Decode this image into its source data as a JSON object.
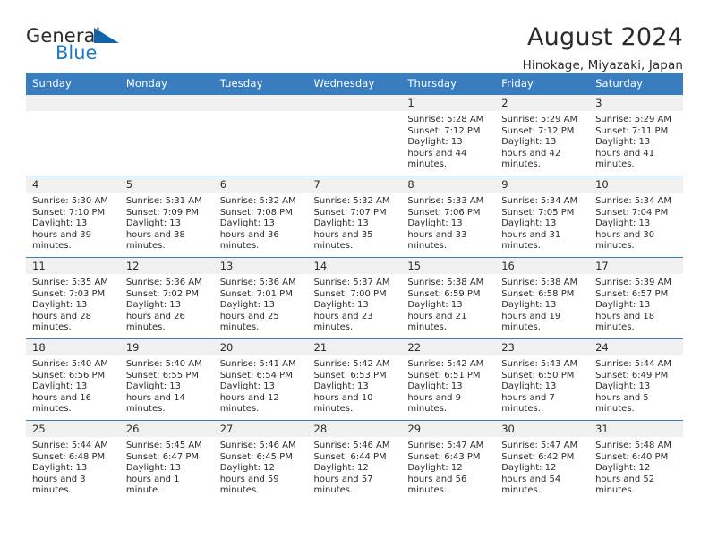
{
  "brand": {
    "name_part1": "General",
    "name_part2": "Blue",
    "flag_icon": "triangle-flag-icon"
  },
  "header": {
    "title": "August 2024",
    "subtitle": "Hinokage, Miyazaki, Japan"
  },
  "colors": {
    "header_blue": "#3a7dbf",
    "brand_blue": "#1f7ac4",
    "flag_blue": "#1164a8",
    "daynum_bg": "#f0f0f0",
    "text": "#2b2b2b"
  },
  "weekdays": [
    "Sunday",
    "Monday",
    "Tuesday",
    "Wednesday",
    "Thursday",
    "Friday",
    "Saturday"
  ],
  "labels": {
    "sunrise_prefix": "Sunrise:",
    "sunset_prefix": "Sunset:",
    "daylight_prefix": "Daylight:"
  },
  "weeks": [
    [
      {
        "day": "",
        "empty": true
      },
      {
        "day": "",
        "empty": true
      },
      {
        "day": "",
        "empty": true
      },
      {
        "day": "",
        "empty": true
      },
      {
        "day": "1",
        "sunrise": "Sunrise: 5:28 AM",
        "sunset": "Sunset: 7:12 PM",
        "daylight": "Daylight: 13 hours and 44 minutes."
      },
      {
        "day": "2",
        "sunrise": "Sunrise: 5:29 AM",
        "sunset": "Sunset: 7:12 PM",
        "daylight": "Daylight: 13 hours and 42 minutes."
      },
      {
        "day": "3",
        "sunrise": "Sunrise: 5:29 AM",
        "sunset": "Sunset: 7:11 PM",
        "daylight": "Daylight: 13 hours and 41 minutes."
      }
    ],
    [
      {
        "day": "4",
        "sunrise": "Sunrise: 5:30 AM",
        "sunset": "Sunset: 7:10 PM",
        "daylight": "Daylight: 13 hours and 39 minutes."
      },
      {
        "day": "5",
        "sunrise": "Sunrise: 5:31 AM",
        "sunset": "Sunset: 7:09 PM",
        "daylight": "Daylight: 13 hours and 38 minutes."
      },
      {
        "day": "6",
        "sunrise": "Sunrise: 5:32 AM",
        "sunset": "Sunset: 7:08 PM",
        "daylight": "Daylight: 13 hours and 36 minutes."
      },
      {
        "day": "7",
        "sunrise": "Sunrise: 5:32 AM",
        "sunset": "Sunset: 7:07 PM",
        "daylight": "Daylight: 13 hours and 35 minutes."
      },
      {
        "day": "8",
        "sunrise": "Sunrise: 5:33 AM",
        "sunset": "Sunset: 7:06 PM",
        "daylight": "Daylight: 13 hours and 33 minutes."
      },
      {
        "day": "9",
        "sunrise": "Sunrise: 5:34 AM",
        "sunset": "Sunset: 7:05 PM",
        "daylight": "Daylight: 13 hours and 31 minutes."
      },
      {
        "day": "10",
        "sunrise": "Sunrise: 5:34 AM",
        "sunset": "Sunset: 7:04 PM",
        "daylight": "Daylight: 13 hours and 30 minutes."
      }
    ],
    [
      {
        "day": "11",
        "sunrise": "Sunrise: 5:35 AM",
        "sunset": "Sunset: 7:03 PM",
        "daylight": "Daylight: 13 hours and 28 minutes."
      },
      {
        "day": "12",
        "sunrise": "Sunrise: 5:36 AM",
        "sunset": "Sunset: 7:02 PM",
        "daylight": "Daylight: 13 hours and 26 minutes."
      },
      {
        "day": "13",
        "sunrise": "Sunrise: 5:36 AM",
        "sunset": "Sunset: 7:01 PM",
        "daylight": "Daylight: 13 hours and 25 minutes."
      },
      {
        "day": "14",
        "sunrise": "Sunrise: 5:37 AM",
        "sunset": "Sunset: 7:00 PM",
        "daylight": "Daylight: 13 hours and 23 minutes."
      },
      {
        "day": "15",
        "sunrise": "Sunrise: 5:38 AM",
        "sunset": "Sunset: 6:59 PM",
        "daylight": "Daylight: 13 hours and 21 minutes."
      },
      {
        "day": "16",
        "sunrise": "Sunrise: 5:38 AM",
        "sunset": "Sunset: 6:58 PM",
        "daylight": "Daylight: 13 hours and 19 minutes."
      },
      {
        "day": "17",
        "sunrise": "Sunrise: 5:39 AM",
        "sunset": "Sunset: 6:57 PM",
        "daylight": "Daylight: 13 hours and 18 minutes."
      }
    ],
    [
      {
        "day": "18",
        "sunrise": "Sunrise: 5:40 AM",
        "sunset": "Sunset: 6:56 PM",
        "daylight": "Daylight: 13 hours and 16 minutes."
      },
      {
        "day": "19",
        "sunrise": "Sunrise: 5:40 AM",
        "sunset": "Sunset: 6:55 PM",
        "daylight": "Daylight: 13 hours and 14 minutes."
      },
      {
        "day": "20",
        "sunrise": "Sunrise: 5:41 AM",
        "sunset": "Sunset: 6:54 PM",
        "daylight": "Daylight: 13 hours and 12 minutes."
      },
      {
        "day": "21",
        "sunrise": "Sunrise: 5:42 AM",
        "sunset": "Sunset: 6:53 PM",
        "daylight": "Daylight: 13 hours and 10 minutes."
      },
      {
        "day": "22",
        "sunrise": "Sunrise: 5:42 AM",
        "sunset": "Sunset: 6:51 PM",
        "daylight": "Daylight: 13 hours and 9 minutes."
      },
      {
        "day": "23",
        "sunrise": "Sunrise: 5:43 AM",
        "sunset": "Sunset: 6:50 PM",
        "daylight": "Daylight: 13 hours and 7 minutes."
      },
      {
        "day": "24",
        "sunrise": "Sunrise: 5:44 AM",
        "sunset": "Sunset: 6:49 PM",
        "daylight": "Daylight: 13 hours and 5 minutes."
      }
    ],
    [
      {
        "day": "25",
        "sunrise": "Sunrise: 5:44 AM",
        "sunset": "Sunset: 6:48 PM",
        "daylight": "Daylight: 13 hours and 3 minutes."
      },
      {
        "day": "26",
        "sunrise": "Sunrise: 5:45 AM",
        "sunset": "Sunset: 6:47 PM",
        "daylight": "Daylight: 13 hours and 1 minute."
      },
      {
        "day": "27",
        "sunrise": "Sunrise: 5:46 AM",
        "sunset": "Sunset: 6:45 PM",
        "daylight": "Daylight: 12 hours and 59 minutes."
      },
      {
        "day": "28",
        "sunrise": "Sunrise: 5:46 AM",
        "sunset": "Sunset: 6:44 PM",
        "daylight": "Daylight: 12 hours and 57 minutes."
      },
      {
        "day": "29",
        "sunrise": "Sunrise: 5:47 AM",
        "sunset": "Sunset: 6:43 PM",
        "daylight": "Daylight: 12 hours and 56 minutes."
      },
      {
        "day": "30",
        "sunrise": "Sunrise: 5:47 AM",
        "sunset": "Sunset: 6:42 PM",
        "daylight": "Daylight: 12 hours and 54 minutes."
      },
      {
        "day": "31",
        "sunrise": "Sunrise: 5:48 AM",
        "sunset": "Sunset: 6:40 PM",
        "daylight": "Daylight: 12 hours and 52 minutes."
      }
    ]
  ]
}
